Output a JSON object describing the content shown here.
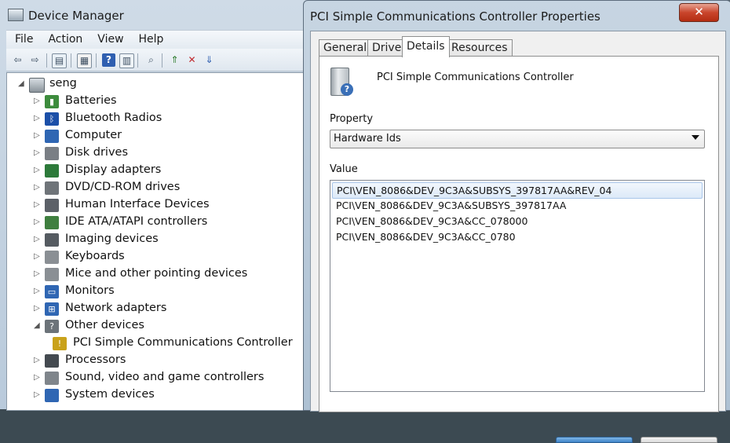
{
  "device_manager": {
    "title": "Device Manager",
    "menu": [
      "File",
      "Action",
      "View",
      "Help"
    ],
    "toolbar_icons": [
      "back-icon",
      "forward-icon",
      "show-hide-console-tree-icon",
      "properties-icon",
      "help-icon",
      "view-icon",
      "scan-hardware-icon",
      "update-driver-icon",
      "uninstall-icon",
      "disable-icon"
    ],
    "root": "seng",
    "items": [
      {
        "label": "Batteries",
        "expander": "▷",
        "icon": "battery-icon",
        "color": "#3d8c3d"
      },
      {
        "label": "Bluetooth Radios",
        "expander": "▷",
        "icon": "bluetooth-icon",
        "color": "#1b4fa8"
      },
      {
        "label": "Computer",
        "expander": "▷",
        "icon": "computer-icon",
        "color": "#2f66b3"
      },
      {
        "label": "Disk drives",
        "expander": "▷",
        "icon": "disk-drive-icon",
        "color": "#7a7f85"
      },
      {
        "label": "Display adapters",
        "expander": "▷",
        "icon": "display-adapter-icon",
        "color": "#2d7a3a"
      },
      {
        "label": "DVD/CD-ROM drives",
        "expander": "▷",
        "icon": "dvd-drive-icon",
        "color": "#6f7479"
      },
      {
        "label": "Human Interface Devices",
        "expander": "▷",
        "icon": "hid-icon",
        "color": "#5c6168"
      },
      {
        "label": "IDE ATA/ATAPI controllers",
        "expander": "▷",
        "icon": "ide-controller-icon",
        "color": "#3f7f3f"
      },
      {
        "label": "Imaging devices",
        "expander": "▷",
        "icon": "camera-icon",
        "color": "#555b61"
      },
      {
        "label": "Keyboards",
        "expander": "▷",
        "icon": "keyboard-icon",
        "color": "#8a8f94"
      },
      {
        "label": "Mice and other pointing devices",
        "expander": "▷",
        "icon": "mouse-icon",
        "color": "#8a8f94"
      },
      {
        "label": "Monitors",
        "expander": "▷",
        "icon": "monitor-icon",
        "color": "#2f66b3"
      },
      {
        "label": "Network adapters",
        "expander": "▷",
        "icon": "network-icon",
        "color": "#2f66b3"
      },
      {
        "label": "Other devices",
        "expander": "◢",
        "icon": "unknown-device-icon",
        "color": "#6c7379"
      },
      {
        "label": "PCI Simple Communications Controller",
        "expander": "",
        "icon": "warning-device-icon",
        "color": "#c9a21a",
        "child": true
      },
      {
        "label": "Processors",
        "expander": "▷",
        "icon": "processor-icon",
        "color": "#444a50"
      },
      {
        "label": "Sound, video and game controllers",
        "expander": "▷",
        "icon": "sound-icon",
        "color": "#7f858b"
      },
      {
        "label": "System devices",
        "expander": "▷",
        "icon": "system-devices-icon",
        "color": "#2f66b3"
      }
    ]
  },
  "properties": {
    "title": "PCI Simple Communications Controller Properties",
    "close_glyph": "✕",
    "tabs": [
      "General",
      "Driver",
      "Details",
      "Resources"
    ],
    "active_tab": "Details",
    "device_name": "PCI Simple Communications Controller",
    "device_badge": "?",
    "property_label": "Property",
    "property_value": "Hardware Ids",
    "value_label": "Value",
    "values": [
      "PCI\\VEN_8086&DEV_9C3A&SUBSYS_397817AA&REV_04",
      "PCI\\VEN_8086&DEV_9C3A&SUBSYS_397817AA",
      "PCI\\VEN_8086&DEV_9C3A&CC_078000",
      "PCI\\VEN_8086&DEV_9C3A&CC_0780"
    ],
    "selected_value_index": 0
  }
}
